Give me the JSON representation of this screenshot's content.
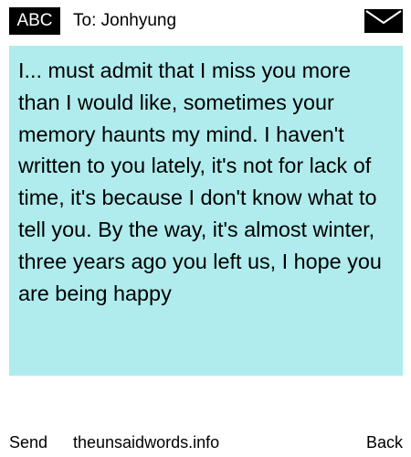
{
  "header": {
    "badge_label": "ABC",
    "to_label": "To: Jonhyung",
    "envelope_icon": "envelope-icon"
  },
  "message": {
    "body": "I... must admit that I miss you more than I would like, sometimes your memory haunts my mind. I haven't written to you lately, it's not for lack of time, it's because I don't know what to tell you. By the way, it's almost winter, three years ago you left us, I hope you are being happy",
    "background_color": "#b0eced"
  },
  "footer": {
    "send_label": "Send",
    "site_label": "theunsaidwords.info",
    "back_label": "Back"
  }
}
